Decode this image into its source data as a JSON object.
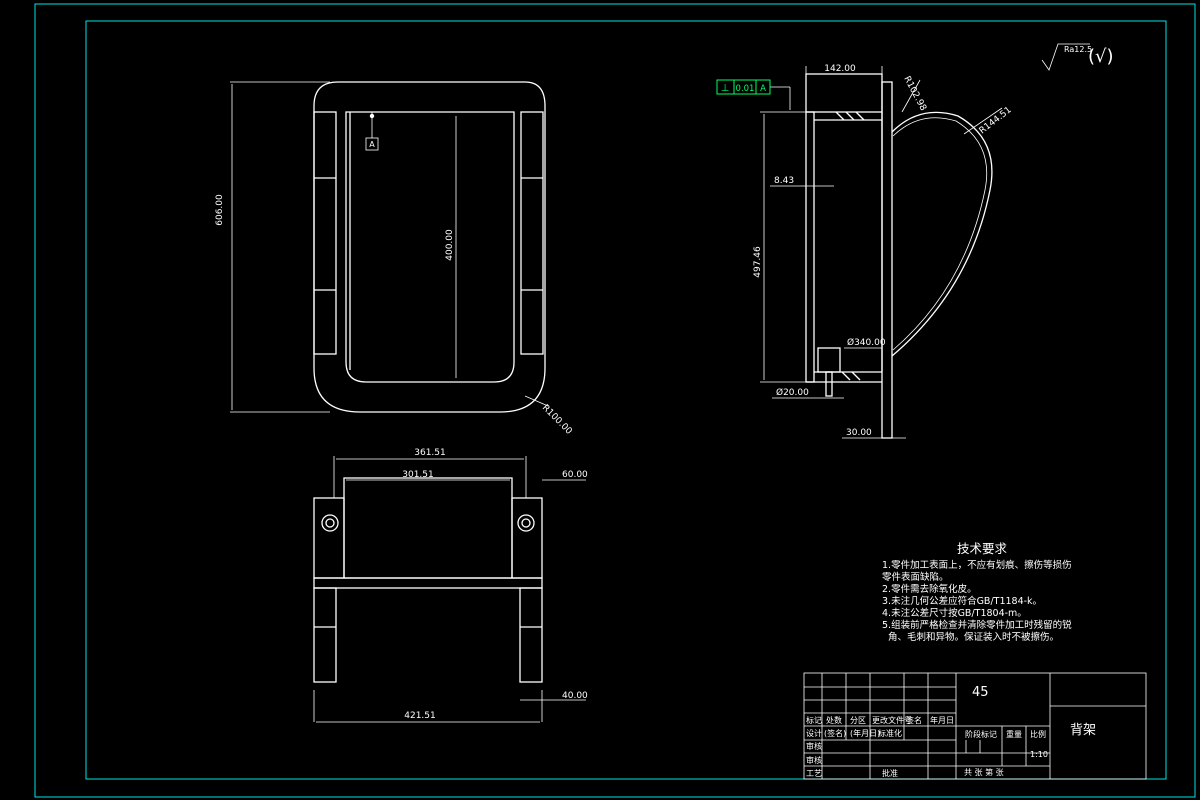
{
  "dimensions": {
    "front_height": "606.00",
    "inner_height": "400.00",
    "fillet_radius": "R100.00",
    "datum_label": "A",
    "top_outer_width": "361.51",
    "top_inner_width": "301.51",
    "flange_width": "60.00",
    "bottom_width": "421.51",
    "foot_width": "40.00",
    "side_top_width": "142.00",
    "side_radius_1": "R102.98",
    "side_radius_2": "R144.51",
    "wall_thickness": "8.43",
    "side_height": "497.46",
    "dia_340": "Ø340.00",
    "dia_20": "Ø20.00",
    "base_width": "30.00"
  },
  "tolerance": {
    "symbol": "⊥",
    "value": "0.01",
    "datum": "A"
  },
  "roughness": {
    "value": "Ra12.5",
    "paren": "(√)"
  },
  "notes": {
    "title": "技术要求",
    "lines": [
      "1.零件加工表面上，不应有划痕、擦伤等损伤",
      "零件表面缺陷。",
      "2.零件需去除氧化皮。",
      "3.未注几何公差应符合GB/T1184-k。",
      "4.未注公差尺寸按GB/T1804-m。",
      "5.组装前严格检查并清除零件加工时残留的锐",
      "角、毛刺和异物。保证装入时不被擦伤。"
    ]
  },
  "title_block": {
    "material": "45",
    "part_name": "背架",
    "row_labels": [
      "标记",
      "处数",
      "分区",
      "更改文件号",
      "签名",
      "年月日"
    ],
    "design_row": [
      "设计",
      "(签名)",
      "(年月日)",
      "标准化"
    ],
    "review_label": "审核",
    "check_label": "审核",
    "process_label": "工艺",
    "approve_label": "批准",
    "stage_label": "阶段标记",
    "weight_label": "重量",
    "scale_label": "比例",
    "scale_value": "1:10",
    "sheet_info": "共  张  第  张"
  }
}
